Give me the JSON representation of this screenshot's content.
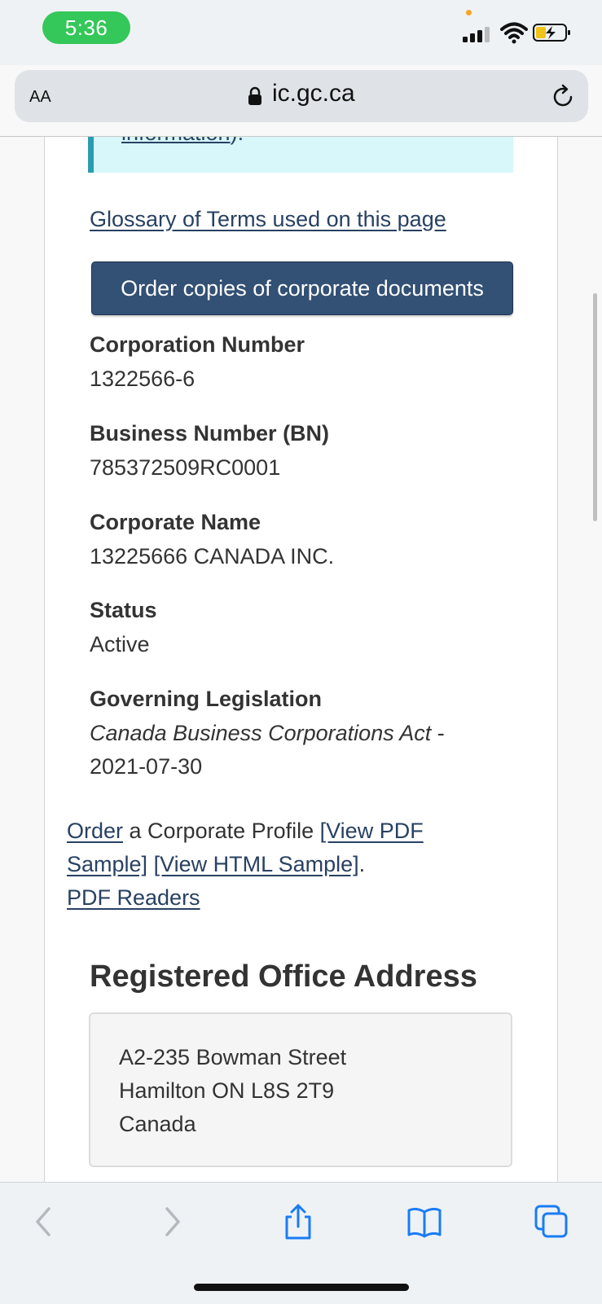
{
  "status_bar": {
    "time": "5:36",
    "icons": [
      "signal-icon",
      "wifi-icon",
      "battery-charging-icon"
    ],
    "time_pill_color": "#34c759"
  },
  "browser": {
    "text_size_label": "AA",
    "url": "ic.gc.ca",
    "icons": [
      "lock-icon",
      "reload-icon"
    ]
  },
  "page": {
    "info_link_partial": "information",
    "info_suffix": ").",
    "glossary_link": "Glossary of Terms used on this page",
    "order_button": "Order copies of corporate documents",
    "fields": [
      {
        "label": "Corporation Number",
        "value": "1322566-6"
      },
      {
        "label": "Business Number (BN)",
        "value": "785372509RC0001"
      },
      {
        "label": "Corporate Name",
        "value": "13225666 CANADA INC."
      },
      {
        "label": "Status",
        "value": "Active"
      },
      {
        "label": "Governing Legislation",
        "value": "Canada Business Corporations Act",
        "value_suffix": " -",
        "date": "2021-07-30"
      }
    ],
    "profile": {
      "order_link": "Order",
      "text": " a Corporate Profile ",
      "pdf_sample_link_1": "[View PDF",
      "pdf_sample_link_2": "Sample]",
      "html_sample_link": "[View HTML Sample]",
      "period": ".",
      "pdf_readers_link": "PDF Readers"
    },
    "registered_office": {
      "heading": "Registered Office Address",
      "lines": [
        "A2-235 Bowman Street",
        "Hamilton ON L8S 2T9",
        "Canada"
      ]
    },
    "colors": {
      "link": "#284162",
      "button": "#335075",
      "info_box": "#d7f7fb",
      "info_border": "#2a9cb0"
    }
  },
  "toolbar": {
    "icons": [
      "back-icon",
      "forward-icon",
      "share-icon",
      "bookmarks-icon",
      "tabs-icon"
    ],
    "accent": "#1a7cf5"
  }
}
